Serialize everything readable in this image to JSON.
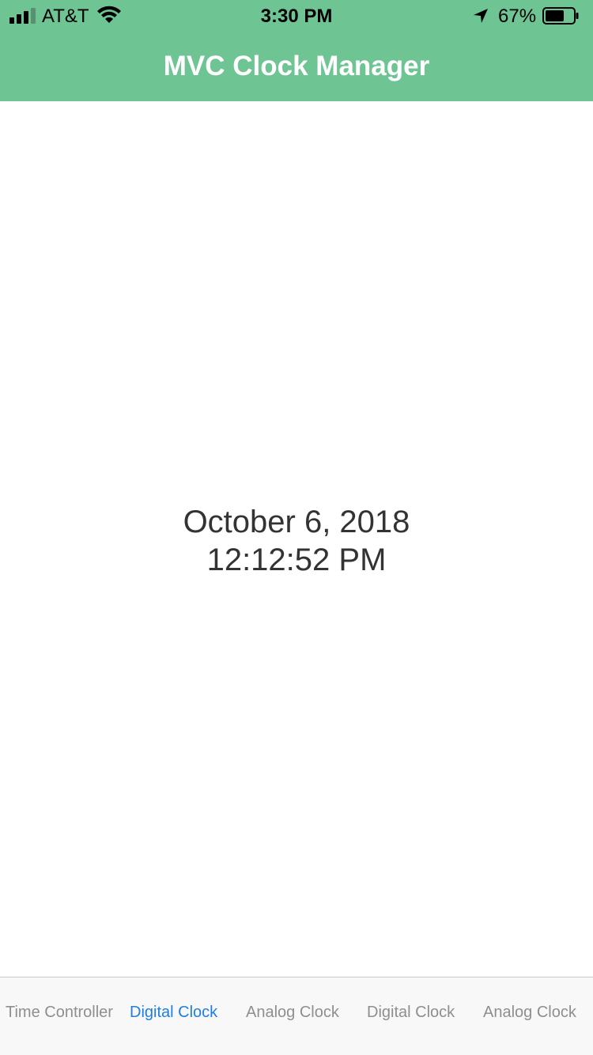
{
  "status_bar": {
    "carrier": "AT&T",
    "time": "3:30 PM",
    "battery_percent": "67%",
    "battery_level": 0.67,
    "signal_bars": 3,
    "icons": [
      "signal-icon",
      "wifi-icon",
      "location-arrow-icon",
      "battery-icon"
    ]
  },
  "header": {
    "title": "MVC Clock Manager",
    "background_color": "#6EC593"
  },
  "main": {
    "date": "October 6, 2018",
    "time": "12:12:52 PM"
  },
  "tab_bar": {
    "active_color": "#1E7FE0",
    "tabs": [
      {
        "label": "Time Controller",
        "active": false
      },
      {
        "label": "Digital Clock",
        "active": true
      },
      {
        "label": "Analog Clock",
        "active": false
      },
      {
        "label": "Digital Clock",
        "active": false
      },
      {
        "label": "Analog Clock",
        "active": false
      }
    ]
  }
}
